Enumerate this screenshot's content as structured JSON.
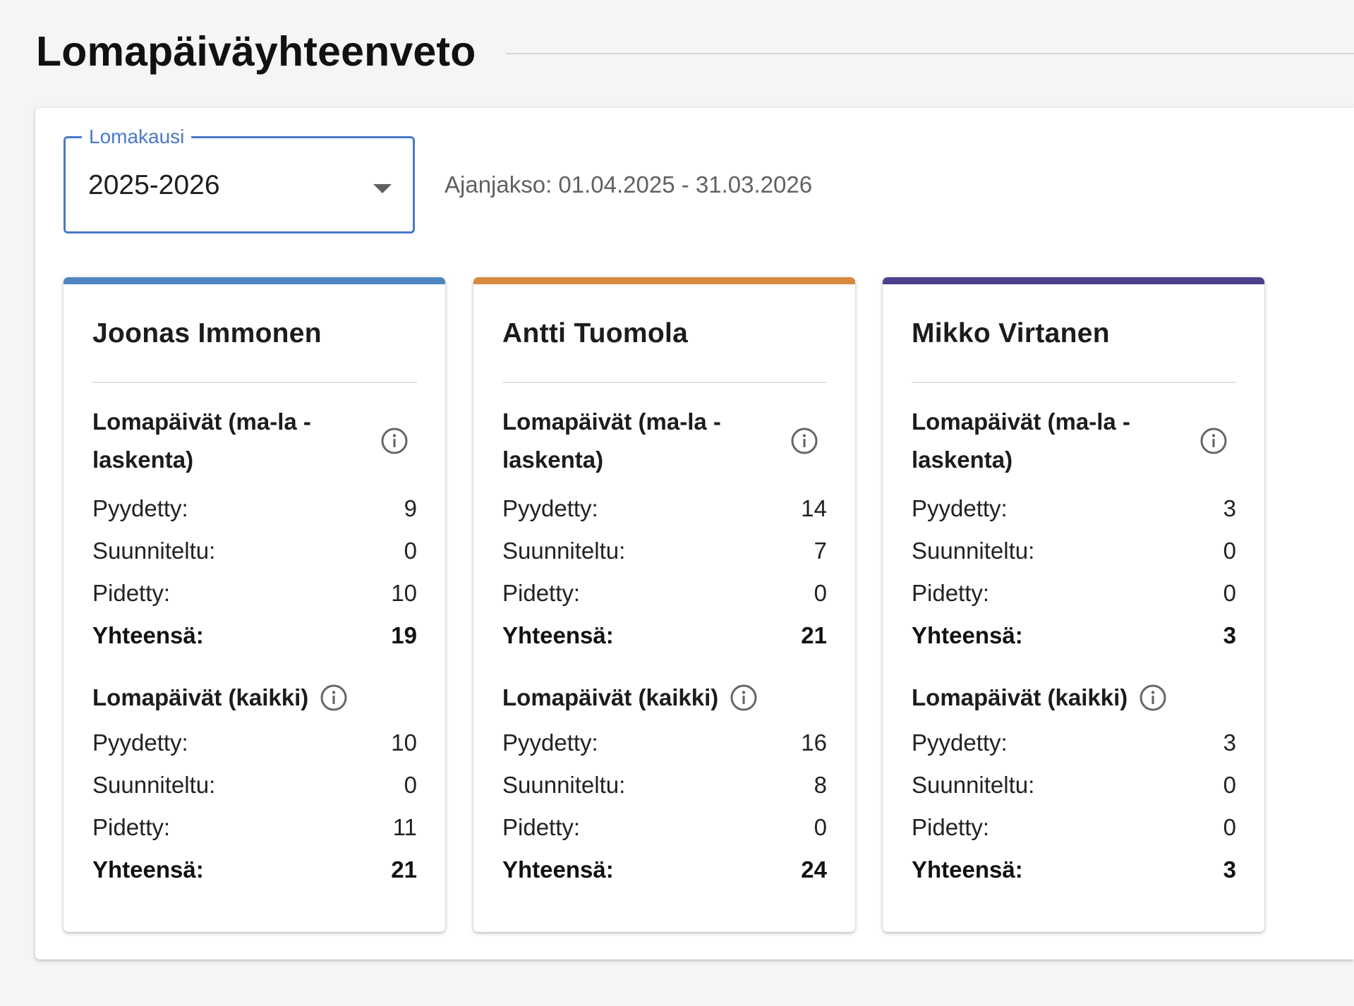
{
  "page": {
    "title": "Lomapäiväyhteenveto"
  },
  "filter": {
    "label": "Lomakausi",
    "selected": "2025-2026",
    "period_text": "Ajanjakso: 01.04.2025 - 31.03.2026"
  },
  "labels": {
    "section_workdays": "Lomapäivät (ma-la - laskenta)",
    "section_all": "Lomapäivät (kaikki)",
    "requested": "Pyydetty:",
    "planned": "Suunniteltu:",
    "taken": "Pidetty:",
    "total": "Yhteensä:"
  },
  "colors": {
    "accent": "#4a78c8",
    "card_1": "#4f86bf",
    "card_2": "#d68a3f",
    "card_3": "#4f3f8c"
  },
  "icons": {
    "info": "info-circle-icon",
    "dropdown": "caret-down-icon"
  },
  "employees": [
    {
      "name": "Joonas Immonen",
      "workdays": {
        "requested": "9",
        "planned": "0",
        "taken": "10",
        "total": "19"
      },
      "all": {
        "requested": "10",
        "planned": "0",
        "taken": "11",
        "total": "21"
      }
    },
    {
      "name": "Antti Tuomola",
      "workdays": {
        "requested": "14",
        "planned": "7",
        "taken": "0",
        "total": "21"
      },
      "all": {
        "requested": "16",
        "planned": "8",
        "taken": "0",
        "total": "24"
      }
    },
    {
      "name": "Mikko Virtanen",
      "workdays": {
        "requested": "3",
        "planned": "0",
        "taken": "0",
        "total": "3"
      },
      "all": {
        "requested": "3",
        "planned": "0",
        "taken": "0",
        "total": "3"
      }
    }
  ]
}
